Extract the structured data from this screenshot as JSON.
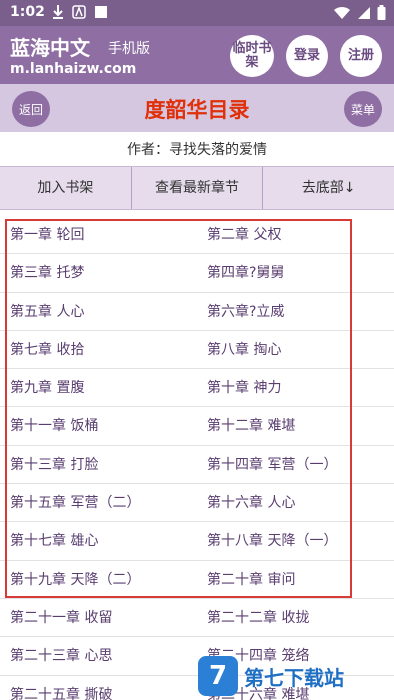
{
  "statusbar": {
    "time": "1:02"
  },
  "header": {
    "site_name": "蓝海中文",
    "site_subtitle": "手机版",
    "site_url": "m.lanhaizw.com",
    "btn_shelf": "临时书架",
    "btn_login": "登录",
    "btn_register": "注册"
  },
  "titlebar": {
    "back": "返回",
    "title": "度韶华目录",
    "menu": "菜单"
  },
  "author": "作者：寻找失落的爱情",
  "actions": [
    "加入书架",
    "查看最新章节",
    "去底部↓"
  ],
  "chapters": [
    [
      "第一章 轮回",
      "第二章 父权"
    ],
    [
      "第三章 托梦",
      "第四章?舅舅"
    ],
    [
      "第五章 人心",
      "第六章?立威"
    ],
    [
      "第七章 收拾",
      "第八章 掏心"
    ],
    [
      "第九章 置腹",
      "第十章 神力"
    ],
    [
      "第十一章 饭桶",
      "第十二章 难堪"
    ],
    [
      "第十三章 打脸",
      "第十四章 军营（一）"
    ],
    [
      "第十五章 军营（二）",
      "第十六章 人心"
    ],
    [
      "第十七章 雄心",
      "第十八章 天降（一）"
    ],
    [
      "第十九章 天降（二）",
      "第二十章 审问"
    ],
    [
      "第二十一章 收留",
      "第二十二章 收拢"
    ],
    [
      "第二十三章 心思",
      "第二十四章 笼络"
    ],
    [
      "第二十五章 撕破",
      "第二十六章 难堪"
    ]
  ],
  "watermark": {
    "logo": "7",
    "text": "第七下载站"
  },
  "colors": {
    "header": "#8e6ea3",
    "title": "#e0300a",
    "highlight": "#d83b35"
  }
}
